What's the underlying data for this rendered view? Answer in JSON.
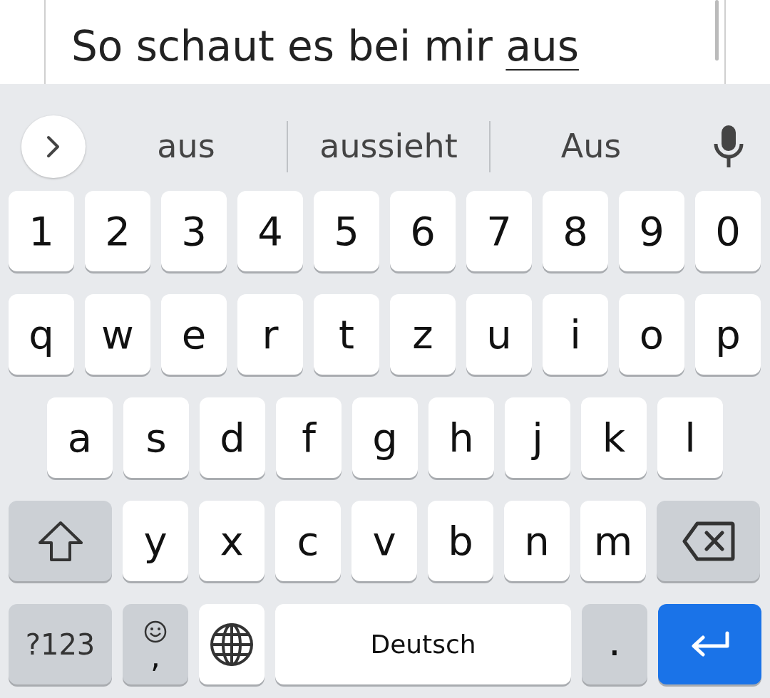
{
  "text_field": {
    "text": "So schaut es bei mir ",
    "composing": "aus"
  },
  "suggestions": [
    "aus",
    "aussieht",
    "Aus"
  ],
  "rows": [
    {
      "keys": [
        {
          "kind": "char",
          "label": "1"
        },
        {
          "kind": "char",
          "label": "2"
        },
        {
          "kind": "char",
          "label": "3"
        },
        {
          "kind": "char",
          "label": "4"
        },
        {
          "kind": "char",
          "label": "5"
        },
        {
          "kind": "char",
          "label": "6"
        },
        {
          "kind": "char",
          "label": "7"
        },
        {
          "kind": "char",
          "label": "8"
        },
        {
          "kind": "char",
          "label": "9"
        },
        {
          "kind": "char",
          "label": "0"
        }
      ]
    },
    {
      "keys": [
        {
          "kind": "char",
          "label": "q"
        },
        {
          "kind": "char",
          "label": "w"
        },
        {
          "kind": "char",
          "label": "e"
        },
        {
          "kind": "char",
          "label": "r"
        },
        {
          "kind": "char",
          "label": "t"
        },
        {
          "kind": "char",
          "label": "z"
        },
        {
          "kind": "char",
          "label": "u"
        },
        {
          "kind": "char",
          "label": "i"
        },
        {
          "kind": "char",
          "label": "o"
        },
        {
          "kind": "char",
          "label": "p"
        }
      ]
    },
    {
      "keys": [
        {
          "kind": "char",
          "label": "a"
        },
        {
          "kind": "char",
          "label": "s"
        },
        {
          "kind": "char",
          "label": "d"
        },
        {
          "kind": "char",
          "label": "f"
        },
        {
          "kind": "char",
          "label": "g"
        },
        {
          "kind": "char",
          "label": "h"
        },
        {
          "kind": "char",
          "label": "j"
        },
        {
          "kind": "char",
          "label": "k"
        },
        {
          "kind": "char",
          "label": "l"
        }
      ]
    },
    {
      "keys": [
        {
          "kind": "shift"
        },
        {
          "kind": "char",
          "label": "y"
        },
        {
          "kind": "char",
          "label": "x"
        },
        {
          "kind": "char",
          "label": "c"
        },
        {
          "kind": "char",
          "label": "v"
        },
        {
          "kind": "char",
          "label": "b"
        },
        {
          "kind": "char",
          "label": "n"
        },
        {
          "kind": "char",
          "label": "m"
        },
        {
          "kind": "backspace"
        }
      ]
    },
    {
      "keys": [
        {
          "kind": "symbols",
          "label": "?123"
        },
        {
          "kind": "emoji_comma",
          "label": ","
        },
        {
          "kind": "globe"
        },
        {
          "kind": "space",
          "label": "Deutsch"
        },
        {
          "kind": "period",
          "label": "."
        },
        {
          "kind": "enter"
        }
      ]
    }
  ]
}
